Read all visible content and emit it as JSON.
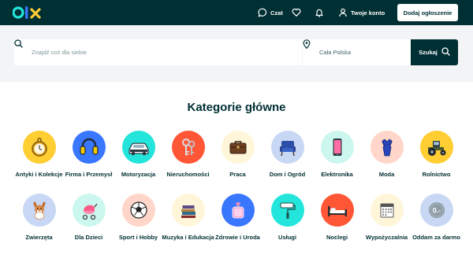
{
  "header": {
    "logo_text": "olx",
    "chat_label": "Czat",
    "account_label": "Twoje konto",
    "post_button_label": "Dodaj ogłoszenie",
    "icons": {
      "chat": "chat-bubble-icon",
      "favorites": "heart-icon",
      "notifications": "bell-icon",
      "account": "user-icon"
    }
  },
  "search": {
    "query_placeholder": "Znajdź coś dla siebie",
    "location_placeholder": "Cała Polska",
    "button_label": "Szukaj",
    "icons": {
      "search": "search-icon",
      "location": "location-pin-icon"
    }
  },
  "categories": {
    "title": "Kategorie główne",
    "items": [
      {
        "label": "Antyki i Kolekcje",
        "icon": "pocket-watch-icon",
        "color": "#ffce32"
      },
      {
        "label": "Firma i Przemysł",
        "icon": "ear-defenders-icon",
        "color": "#3a77ff"
      },
      {
        "label": "Motoryzacja",
        "icon": "car-icon",
        "color": "#23e5db"
      },
      {
        "label": "Nieruchomości",
        "icon": "keys-icon",
        "color": "#ff5636"
      },
      {
        "label": "Praca",
        "icon": "briefcase-icon",
        "color": "#fff6d9"
      },
      {
        "label": "Dom i Ogród",
        "icon": "armchair-icon",
        "color": "#c8d7f4"
      },
      {
        "label": "Elektronika",
        "icon": "smartphone-icon",
        "color": "#cbf7ee"
      },
      {
        "label": "Moda",
        "icon": "dress-icon",
        "color": "#ffd6c9"
      },
      {
        "label": "Rolnictwo",
        "icon": "tractor-icon",
        "color": "#ffce32"
      },
      {
        "label": "Zwierzęta",
        "icon": "dog-icon",
        "color": "#c8d7f4"
      },
      {
        "label": "Dla Dzieci",
        "icon": "stroller-icon",
        "color": "#cbf7ee"
      },
      {
        "label": "Sport i Hobby",
        "icon": "ball-icon",
        "color": "#ffd6c9"
      },
      {
        "label": "Muzyka i Edukacja",
        "icon": "books-icon",
        "color": "#fff6d9"
      },
      {
        "label": "Zdrowie i Uroda",
        "icon": "perfume-icon",
        "color": "#3a77ff"
      },
      {
        "label": "Usługi",
        "icon": "paint-roller-icon",
        "color": "#23e5db"
      },
      {
        "label": "Noclegi",
        "icon": "bed-icon",
        "color": "#ff5636"
      },
      {
        "label": "Wypożyczalnia",
        "icon": "calendar-icon",
        "color": "#fff6d9"
      },
      {
        "label": "Oddam za darmo",
        "icon": "zero-coin-icon",
        "color": "#c8d7f4",
        "coin_text": "0.-"
      }
    ]
  },
  "colors": {
    "primary": "#002f34",
    "search_band": "#f2f4f5",
    "placeholder": "#7f9799"
  }
}
